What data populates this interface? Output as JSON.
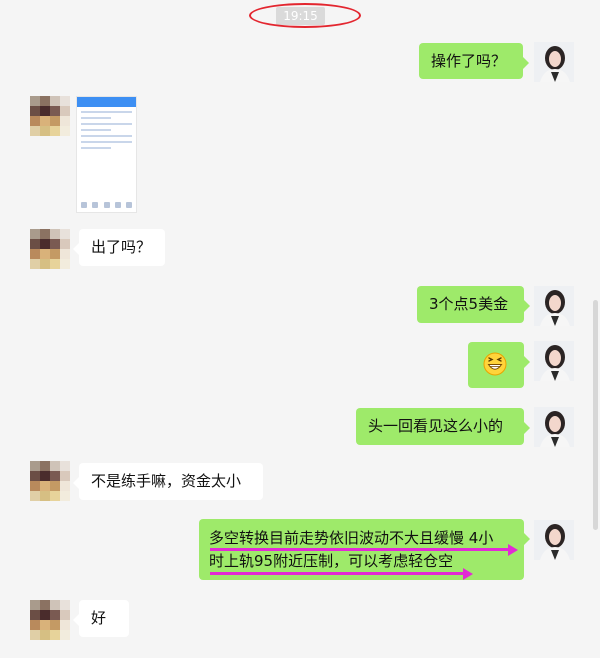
{
  "timestamp": "19:15",
  "messages": [
    {
      "side": "me",
      "text": "操作了吗？"
    },
    {
      "side": "other",
      "type": "image"
    },
    {
      "side": "other",
      "text": "出了吗？"
    },
    {
      "side": "me",
      "text": "3个点5美金"
    },
    {
      "side": "me",
      "type": "emoji",
      "emoji": "grinning-face"
    },
    {
      "side": "me",
      "text": "头一回看见这么小的"
    },
    {
      "side": "other",
      "text": "不是练手嘛，资金太小"
    },
    {
      "side": "me",
      "lines": [
        "多空转换目前走势依旧波动不大且缓慢 4小",
        "时上轨95附近压制，可以考虑轻仓空"
      ]
    },
    {
      "side": "other",
      "text": "好"
    }
  ],
  "colors": {
    "me_bubble": "#9eea6a",
    "other_bubble": "#ffffff",
    "annotation_circle": "#e3262f",
    "annotation_arrow": "#e22bd4"
  }
}
